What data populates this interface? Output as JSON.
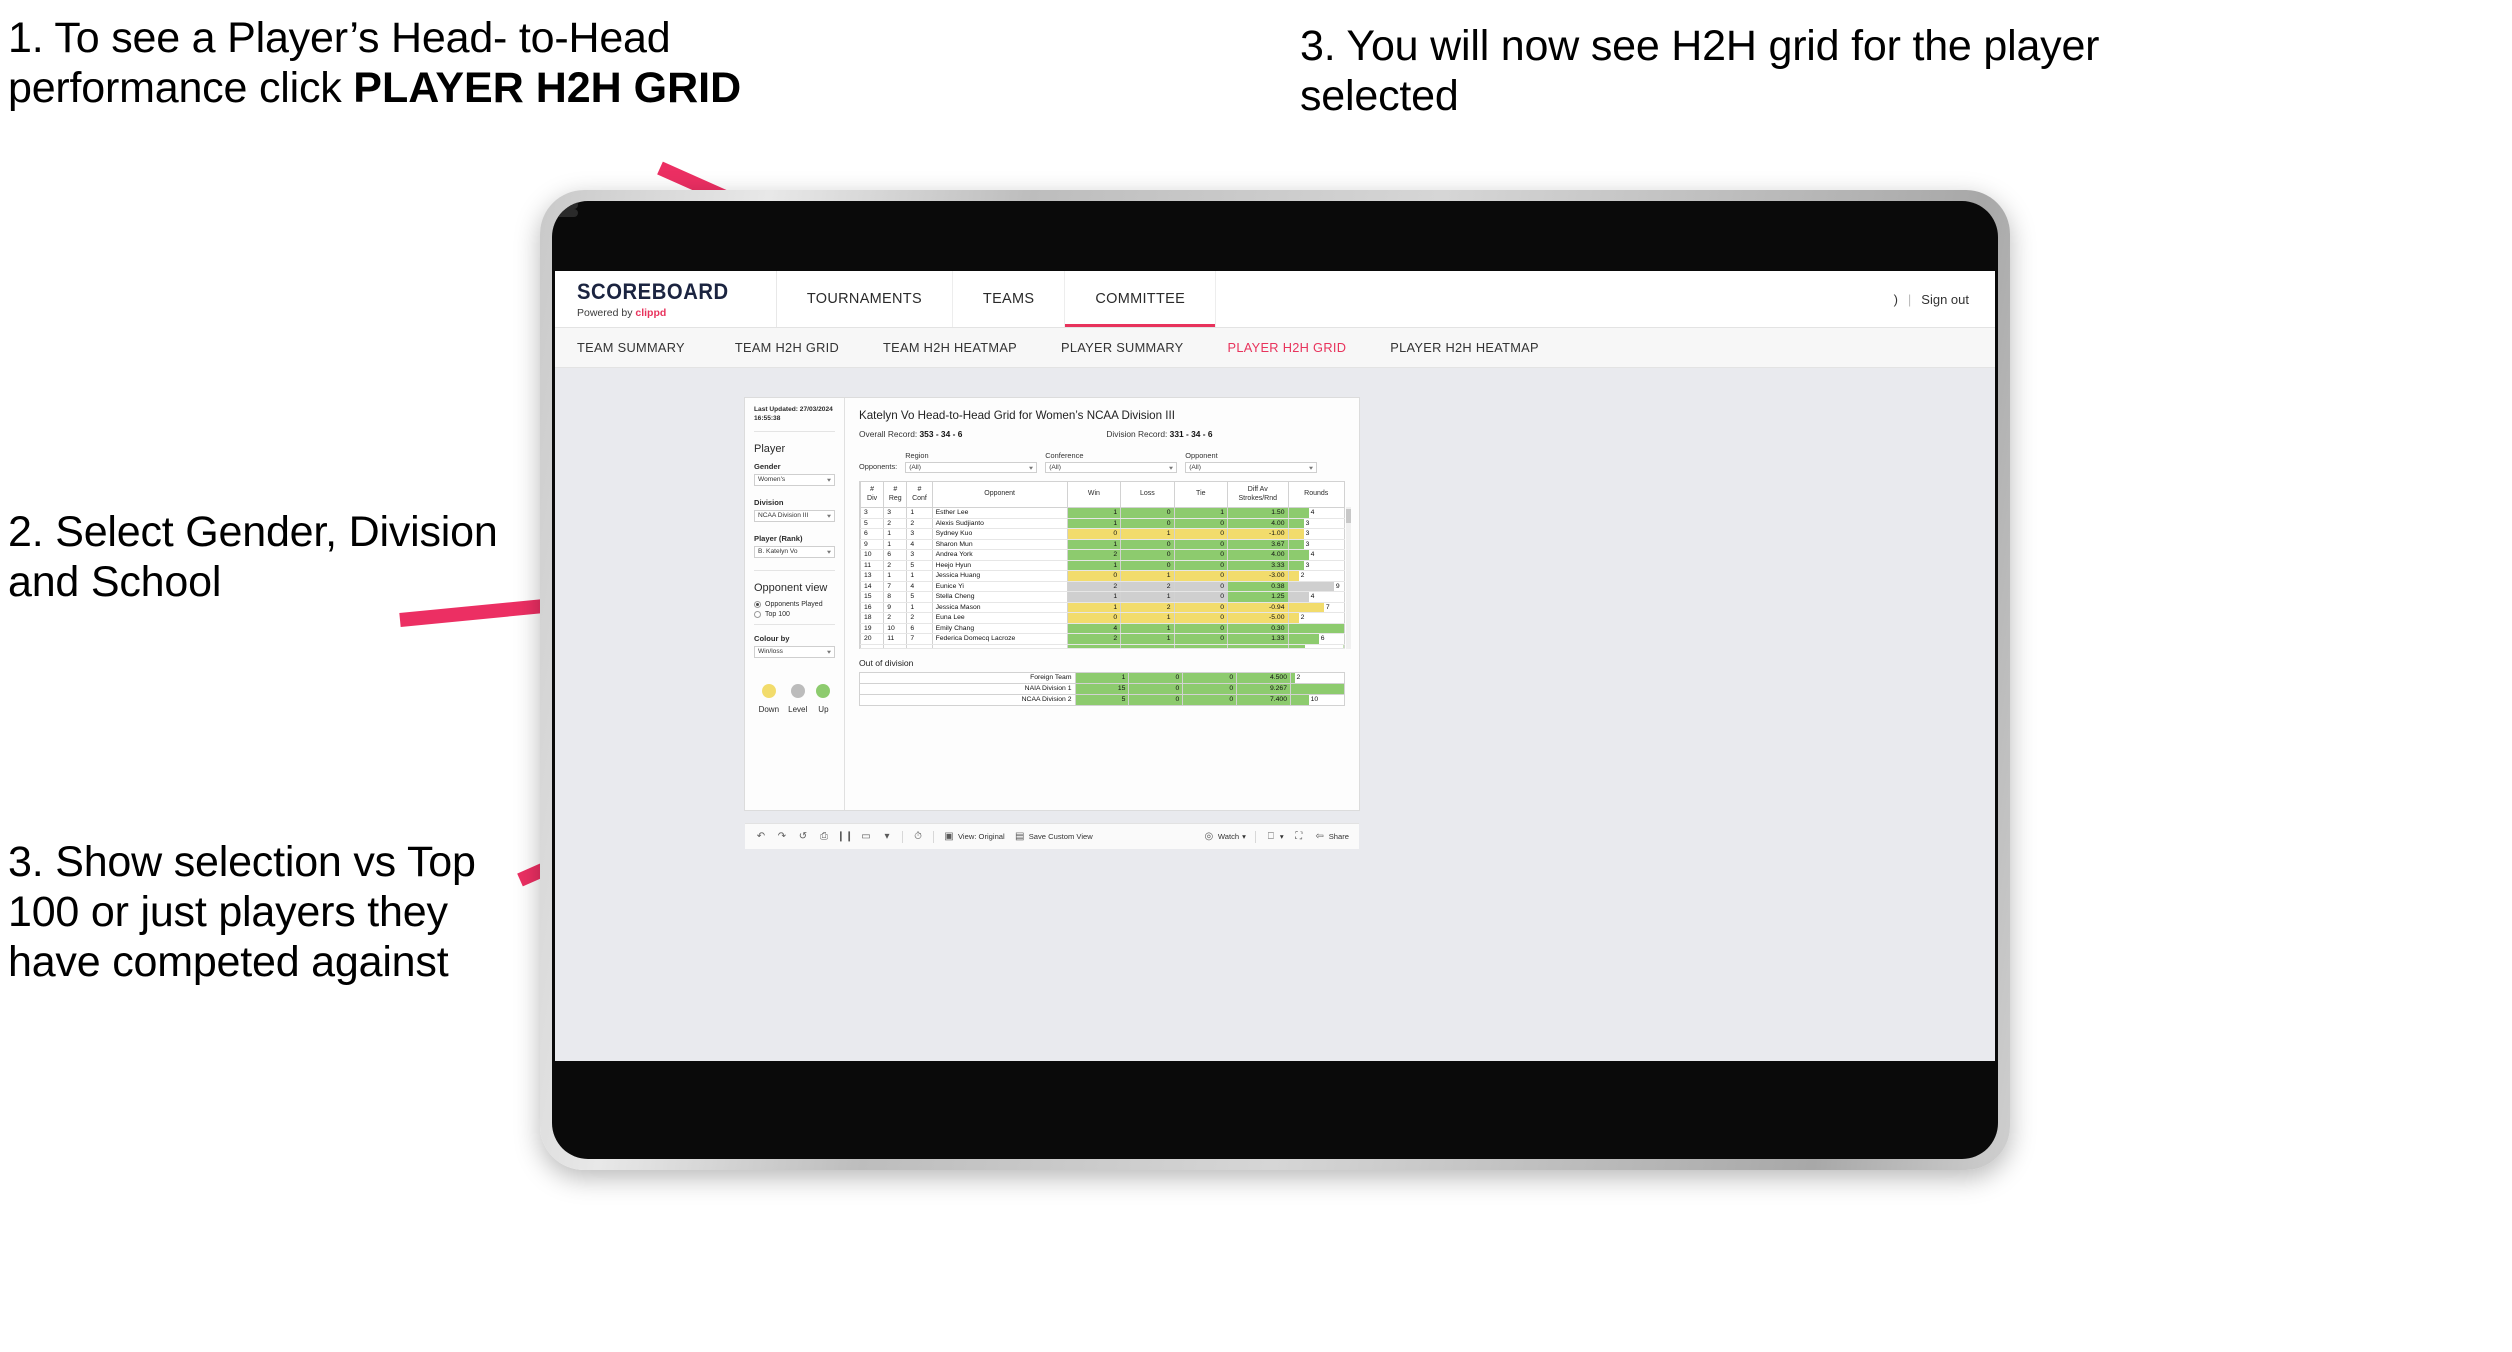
{
  "annotations": [
    {
      "id": "a1",
      "line1": "1. To see a Player’s Head-",
      "line2": "to-Head performance click",
      "bold": "PLAYER H2H GRID"
    },
    {
      "id": "a2",
      "text": "2. Select Gender, Division and School"
    },
    {
      "id": "a3",
      "text": "3. Show selection vs Top 100 or just players they have competed against"
    },
    {
      "id": "a4",
      "text": "3. You will now see H2H grid for the player selected"
    }
  ],
  "app": {
    "brand": {
      "title": "SCOREBOARD",
      "powered_prefix": "Powered by ",
      "powered_name": "clippd"
    },
    "topnav": [
      {
        "label": "TOURNAMENTS",
        "active": false
      },
      {
        "label": "TEAMS",
        "active": false
      },
      {
        "label": "COMMITTEE",
        "active": true
      }
    ],
    "topbar_right": {
      "user": ")",
      "separator": "|",
      "signout": "Sign out"
    },
    "subnav": [
      {
        "label": "TEAM SUMMARY",
        "active": false
      },
      {
        "label": "TEAM H2H GRID",
        "active": false
      },
      {
        "label": "TEAM H2H HEATMAP",
        "active": false
      },
      {
        "label": "PLAYER SUMMARY",
        "active": false
      },
      {
        "label": "PLAYER H2H GRID",
        "active": true
      },
      {
        "label": "PLAYER H2H HEATMAP",
        "active": false
      }
    ],
    "sidebar": {
      "last_updated_label": "Last Updated: 27/03/2024",
      "last_updated_time": "16:55:38",
      "player_heading": "Player",
      "gender_label": "Gender",
      "gender_value": "Women's",
      "division_label": "Division",
      "division_value": "NCAA Division III",
      "player_rank_label": "Player (Rank)",
      "player_rank_value": "B. Katelyn Vo",
      "opponent_view_heading": "Opponent view",
      "opponent_view_options": [
        {
          "label": "Opponents Played",
          "selected": true
        },
        {
          "label": "Top 100",
          "selected": false
        }
      ],
      "colour_by_label": "Colour by",
      "colour_by_value": "Win/loss",
      "legend": [
        {
          "label": "Down",
          "color": "#f2dc6c"
        },
        {
          "label": "Level",
          "color": "#bcbcbc"
        },
        {
          "label": "Up",
          "color": "#8dcb6e"
        }
      ]
    },
    "viz": {
      "title": "Katelyn Vo Head-to-Head Grid for Women’s NCAA Division III",
      "overall_record_label": "Overall Record:",
      "overall_record_value": "353 - 34 - 6",
      "division_record_label": "Division Record:",
      "division_record_value": "331 - 34 - 6",
      "opponents_label": "Opponents:",
      "filters": [
        {
          "label": "Region",
          "value": "(All)"
        },
        {
          "label": "Conference",
          "value": "(All)"
        },
        {
          "label": "Opponent",
          "value": "(All)"
        }
      ],
      "out_of_division_title": "Out of division"
    },
    "toolbar": {
      "view_label": "View: Original",
      "save_label": "Save Custom View",
      "watch_label": "Watch",
      "share_label": "Share"
    }
  },
  "chart_data": {
    "type": "table",
    "title": "Katelyn Vo Head-to-Head Grid for Women’s NCAA Division III",
    "columns": [
      "# Div",
      "# Reg",
      "# Conf",
      "Opponent",
      "Win",
      "Loss",
      "Tie",
      "Diff Av Strokes/Rnd",
      "Rounds"
    ],
    "column_headers_multiline": [
      {
        "l1": "#",
        "l2": "Div"
      },
      {
        "l1": "#",
        "l2": "Reg"
      },
      {
        "l1": "#",
        "l2": "Conf"
      },
      {
        "l1": "Opponent",
        "l2": ""
      },
      {
        "l1": "Win",
        "l2": ""
      },
      {
        "l1": "Loss",
        "l2": ""
      },
      {
        "l1": "Tie",
        "l2": ""
      },
      {
        "l1": "Diff Av",
        "l2": "Strokes/Rnd"
      },
      {
        "l1": "Rounds",
        "l2": ""
      }
    ],
    "rounds_max": 11,
    "rows": [
      {
        "div": "3",
        "reg": "3",
        "conf": "1",
        "opponent": "Esther Lee",
        "win": "1",
        "loss": "0",
        "tie": "1",
        "diff": "1.50",
        "rounds": "4",
        "state": "up",
        "diff_state": "up"
      },
      {
        "div": "5",
        "reg": "2",
        "conf": "2",
        "opponent": "Alexis Sudjianto",
        "win": "1",
        "loss": "0",
        "tie": "0",
        "diff": "4.00",
        "rounds": "3",
        "state": "up",
        "diff_state": "up"
      },
      {
        "div": "6",
        "reg": "1",
        "conf": "3",
        "opponent": "Sydney Kuo",
        "win": "0",
        "loss": "1",
        "tie": "0",
        "diff": "-1.00",
        "rounds": "3",
        "state": "down",
        "diff_state": "down"
      },
      {
        "div": "9",
        "reg": "1",
        "conf": "4",
        "opponent": "Sharon Mun",
        "win": "1",
        "loss": "0",
        "tie": "0",
        "diff": "3.67",
        "rounds": "3",
        "state": "up",
        "diff_state": "up"
      },
      {
        "div": "10",
        "reg": "6",
        "conf": "3",
        "opponent": "Andrea York",
        "win": "2",
        "loss": "0",
        "tie": "0",
        "diff": "4.00",
        "rounds": "4",
        "state": "up",
        "diff_state": "up"
      },
      {
        "div": "11",
        "reg": "2",
        "conf": "5",
        "opponent": "Heejo Hyun",
        "win": "1",
        "loss": "0",
        "tie": "0",
        "diff": "3.33",
        "rounds": "3",
        "state": "up",
        "diff_state": "up"
      },
      {
        "div": "13",
        "reg": "1",
        "conf": "1",
        "opponent": "Jessica Huang",
        "win": "0",
        "loss": "1",
        "tie": "0",
        "diff": "-3.00",
        "rounds": "2",
        "state": "down",
        "diff_state": "down"
      },
      {
        "div": "14",
        "reg": "7",
        "conf": "4",
        "opponent": "Eunice Yi",
        "win": "2",
        "loss": "2",
        "tie": "0",
        "diff": "0.38",
        "rounds": "9",
        "state": "level",
        "diff_state": "up"
      },
      {
        "div": "15",
        "reg": "8",
        "conf": "5",
        "opponent": "Stella Cheng",
        "win": "1",
        "loss": "1",
        "tie": "0",
        "diff": "1.25",
        "rounds": "4",
        "state": "level",
        "diff_state": "up"
      },
      {
        "div": "16",
        "reg": "9",
        "conf": "1",
        "opponent": "Jessica Mason",
        "win": "1",
        "loss": "2",
        "tie": "0",
        "diff": "-0.94",
        "rounds": "7",
        "state": "down",
        "diff_state": "down"
      },
      {
        "div": "18",
        "reg": "2",
        "conf": "2",
        "opponent": "Euna Lee",
        "win": "0",
        "loss": "1",
        "tie": "0",
        "diff": "-5.00",
        "rounds": "2",
        "state": "down",
        "diff_state": "down"
      },
      {
        "div": "19",
        "reg": "10",
        "conf": "6",
        "opponent": "Emily Chang",
        "win": "4",
        "loss": "1",
        "tie": "0",
        "diff": "0.30",
        "rounds": "11",
        "state": "up",
        "diff_state": "up"
      },
      {
        "div": "20",
        "reg": "11",
        "conf": "7",
        "opponent": "Federica Domecq Lacroze",
        "win": "2",
        "loss": "1",
        "tie": "0",
        "diff": "1.33",
        "rounds": "6",
        "state": "up",
        "diff_state": "up"
      }
    ],
    "out_of_division": {
      "title": "Out of division",
      "rounds_max": 30,
      "rows": [
        {
          "name": "Foreign Team",
          "win": "1",
          "loss": "0",
          "tie": "0",
          "diff": "4.500",
          "rounds": "2",
          "state": "up",
          "diff_state": "up"
        },
        {
          "name": "NAIA Division 1",
          "win": "15",
          "loss": "0",
          "tie": "0",
          "diff": "9.267",
          "rounds": "30",
          "state": "up",
          "diff_state": "up"
        },
        {
          "name": "NCAA Division 2",
          "win": "5",
          "loss": "0",
          "tie": "0",
          "diff": "7.400",
          "rounds": "10",
          "state": "up",
          "diff_state": "up"
        }
      ]
    },
    "colors": {
      "up": "#8dcb6e",
      "down": "#f2dc6c",
      "level": "#cfcfcf",
      "accent": "#e8335c",
      "arrow": "#ec2f63"
    }
  }
}
